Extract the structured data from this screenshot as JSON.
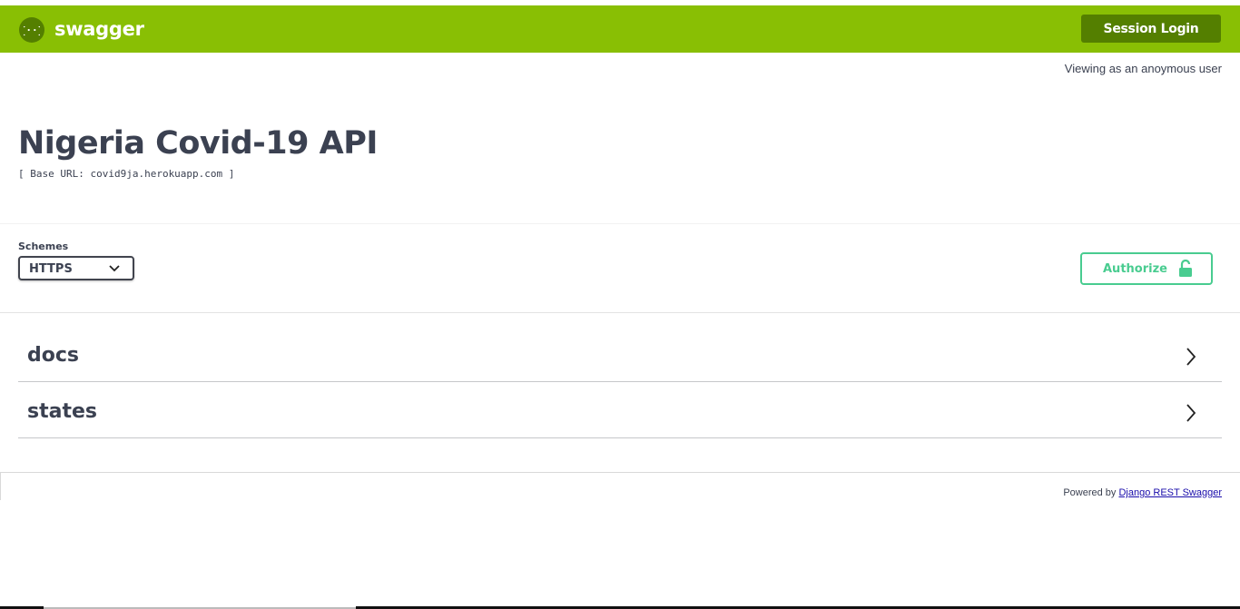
{
  "header": {
    "logo_text": "swagger",
    "logo_icon": "swagger-braces-icon",
    "session_login_label": "Session Login",
    "brand_color": "#89bf04",
    "brand_dark_color": "#547f00"
  },
  "viewing_text": "Viewing as an anoymous user",
  "info": {
    "title": "Nigeria Covid-19 API",
    "base_url": "[ Base URL: covid9ja.herokuapp.com ]"
  },
  "schemes": {
    "label": "Schemes",
    "selected": "HTTPS"
  },
  "authorize": {
    "label": "Authorize",
    "icon": "unlocked-padlock-icon",
    "color": "#49cc90"
  },
  "tags": [
    {
      "name": "docs",
      "icon": "chevron-right-icon"
    },
    {
      "name": "states",
      "icon": "chevron-right-icon"
    }
  ],
  "footer": {
    "powered_prefix": "Powered by",
    "powered_link": "Django REST Swagger"
  }
}
